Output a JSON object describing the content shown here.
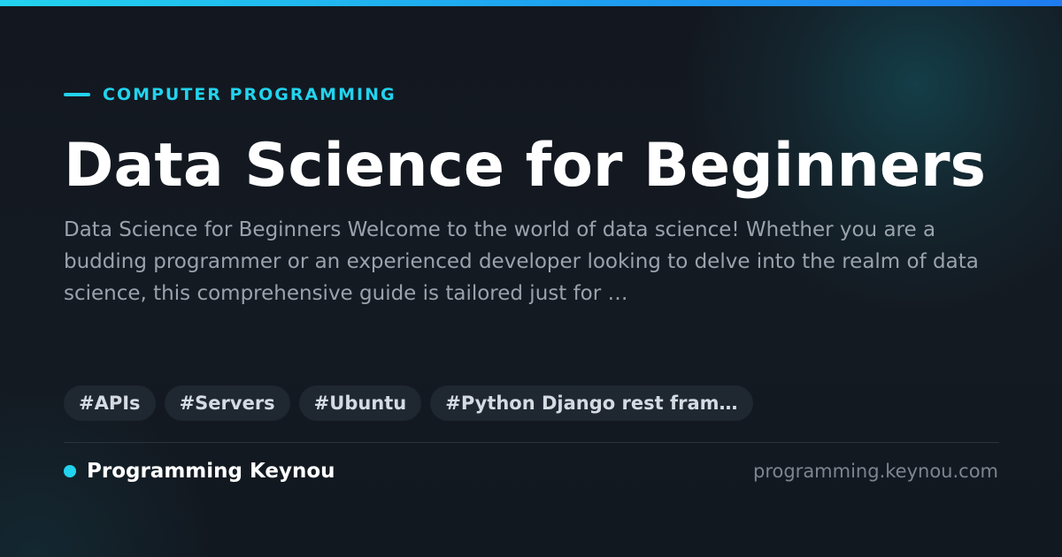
{
  "theme": {
    "accent": "#22d3ee",
    "gradient_end": "#1e7cf0",
    "background": "#131820",
    "title_color": "#ffffff",
    "excerpt_color": "#9aa3ad",
    "tag_background": "#1f2731",
    "tag_text": "#d5dbe2",
    "domain_color": "#7c8590"
  },
  "kicker": {
    "category": "COMPUTER PROGRAMMING"
  },
  "article": {
    "title": "Data Science for Beginners",
    "excerpt": "Data Science for Beginners Welcome to the world of data science! Whether you are a budding programmer or an experienced developer looking to delve into the realm of data science, this comprehensive guide is tailored just for …"
  },
  "tags": [
    "#APIs",
    "#Servers",
    "#Ubuntu",
    "#Python Django rest fram…"
  ],
  "footer": {
    "brand_name": "Programming Keynou",
    "domain": "programming.keynou.com"
  }
}
